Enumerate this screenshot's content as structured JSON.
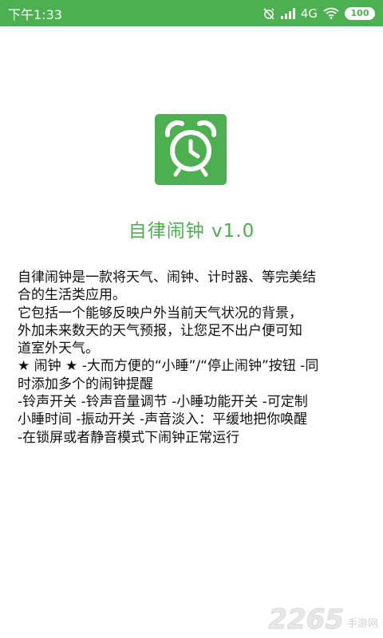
{
  "status_bar": {
    "time": "下午1:33",
    "network": "4G",
    "battery": "100",
    "icons": [
      "alarm-off-icon",
      "signal-icon",
      "wifi-icon",
      "battery-icon"
    ]
  },
  "app": {
    "icon": "alarm-clock-icon",
    "title": "自律闹钟 v1.0",
    "accent_color": "#4caf50"
  },
  "description": {
    "lines": [
      "自律闹钟是一款将天气、闹钟、计时器、等完美结",
      "合的生活类应用。",
      "它包括一个能够反映户外当前天气状况的背景，",
      "外加未来数天的天气预报，让您足不出户便可知",
      "道室外天气。",
      "★ 闹钟 ★ -大而方便的“小睡”/“停止闹钟”按钮 -同",
      "时添加多个的闹钟提醒",
      "-铃声开关 -铃声音量调节 -小睡功能开关 -可定制",
      "小睡时间 -振动开关 -声音淡入：平缓地把你唤醒",
      "-在锁屏或者静音模式下闹钟正常运行"
    ]
  },
  "watermark": {
    "number": "2265",
    "text": "手游网"
  }
}
